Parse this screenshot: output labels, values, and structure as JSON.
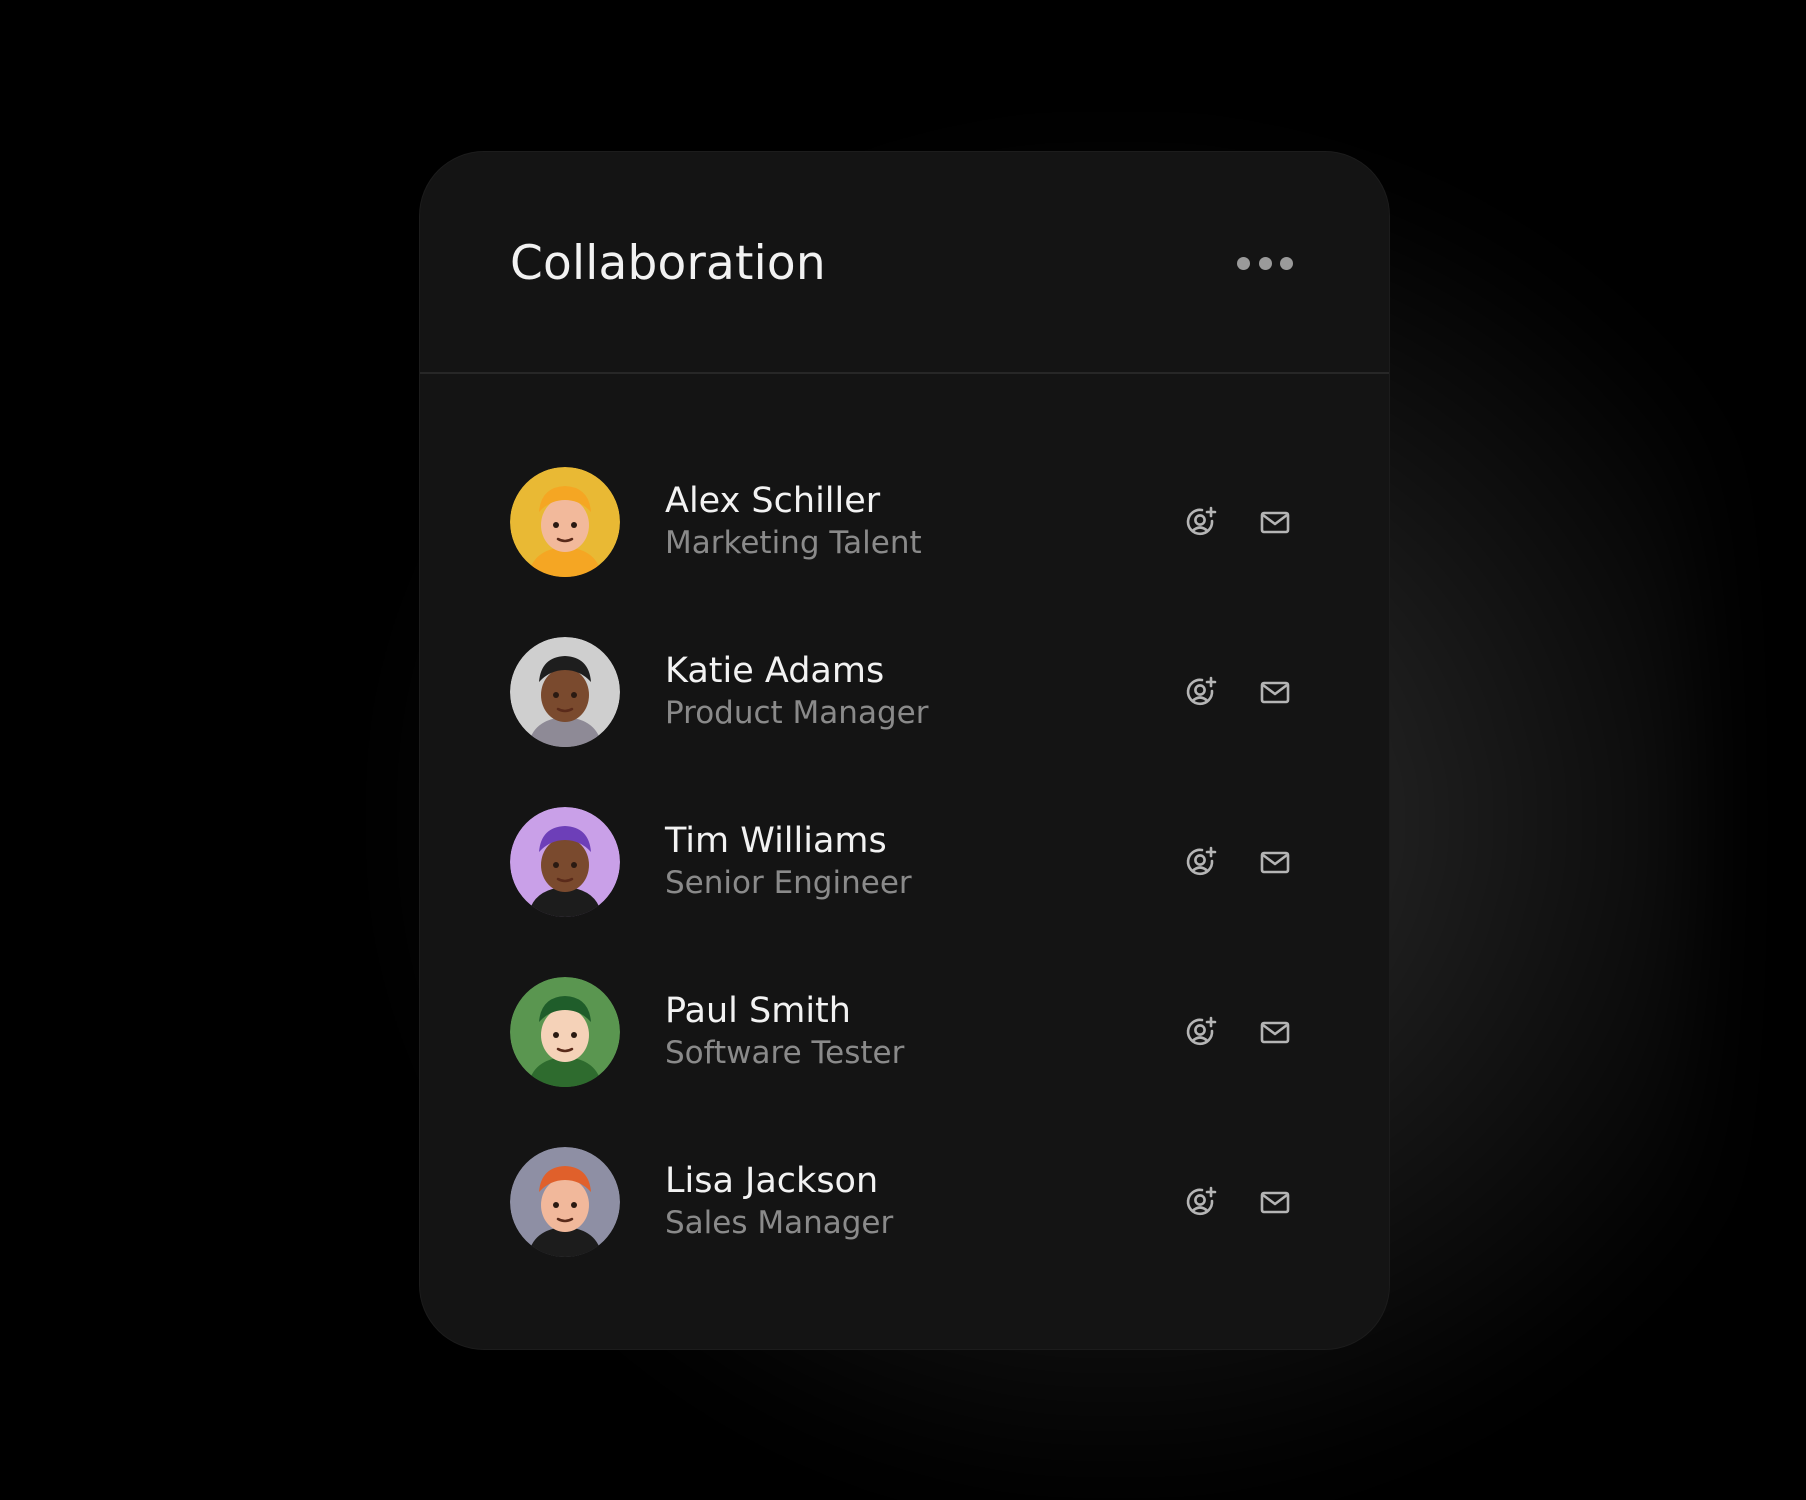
{
  "card": {
    "title": "Collaboration",
    "more_icon": "more-horizontal-icon"
  },
  "members": [
    {
      "name": "Alex Schiller",
      "role": "Marketing Talent",
      "avatar_bg": "#e9b934",
      "skin": "#f2b99b",
      "hat": "#f5a623",
      "shirt": "#f5a623"
    },
    {
      "name": "Katie Adams",
      "role": "Product Manager",
      "avatar_bg": "#cfcfcf",
      "skin": "#7a4a2e",
      "hat": "#1e1e1e",
      "shirt": "#8e8a96"
    },
    {
      "name": "Tim Williams",
      "role": "Senior Engineer",
      "avatar_bg": "#c9a0e8",
      "skin": "#7a4a2e",
      "hat": "#6d3fb8",
      "shirt": "#1c1c1c"
    },
    {
      "name": "Paul Smith",
      "role": "Software Tester",
      "avatar_bg": "#5a9650",
      "skin": "#f5d2b8",
      "hat": "#1f5d2a",
      "shirt": "#2e6b2e"
    },
    {
      "name": "Lisa Jackson",
      "role": "Sales Manager",
      "avatar_bg": "#8e8fa4",
      "skin": "#f1b89b",
      "hat": "#e0602b",
      "shirt": "#1c1c1c"
    }
  ],
  "icons": {
    "add_user": "add-user-icon",
    "mail": "mail-icon"
  },
  "colors": {
    "background": "#000000",
    "card": "#141414",
    "divider": "#272727",
    "title": "#f2f2f2",
    "subtitle": "#8a8a8a",
    "icon": "#b5b5b5"
  }
}
